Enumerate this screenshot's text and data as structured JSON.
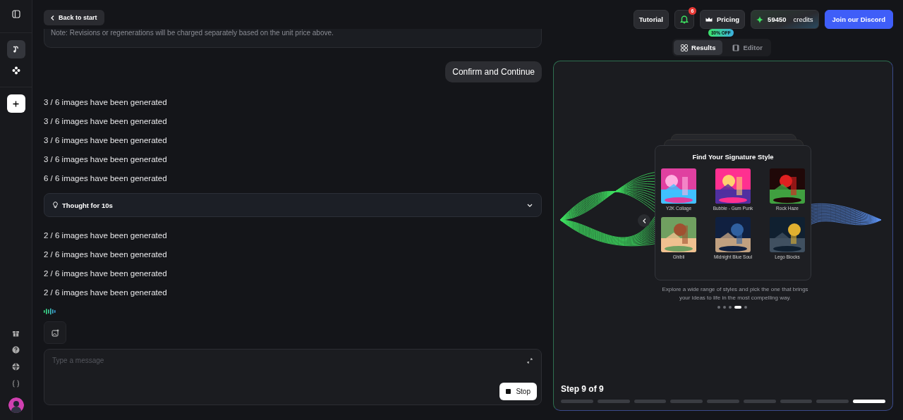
{
  "header": {
    "back": "Back to start",
    "tutorial": "Tutorial",
    "notifications": "6",
    "pricing": "Pricing",
    "discount": "30% OFF",
    "credits_value": "59450",
    "credits_label": "credits",
    "discord": "Join our Discord"
  },
  "view_tabs": [
    {
      "label": "Results",
      "selected": true
    },
    {
      "label": "Editor",
      "selected": false
    }
  ],
  "sidebar": {
    "items": [
      {
        "kind": "music",
        "selected": true
      },
      {
        "kind": "nodes",
        "selected": false
      }
    ]
  },
  "note": "Note: Revisions or regenerations will be charged separately based on the unit price above.",
  "user_message": "Confirm and Continue",
  "progress_messages_1": [
    "3 / 6 images have been generated",
    "3 / 6 images have been generated",
    "3 / 6 images have been generated",
    "3 / 6 images have been generated",
    "6 / 6 images have been generated"
  ],
  "thought": {
    "label": "Thought for 10s",
    "expanded": false
  },
  "progress_messages_2": [
    "2 / 6 images have been generated",
    "2 / 6 images have been generated",
    "2 / 6 images have been generated",
    "2 / 6 images have been generated"
  ],
  "composer": {
    "placeholder": "Type a message",
    "stop": "Stop"
  },
  "showcase": {
    "title": "Find Your Signature Style",
    "styles": [
      {
        "label": "Y2K Collage",
        "kind": "picture"
      },
      {
        "label": "Bubble - Gum Punk",
        "kind": "picture"
      },
      {
        "label": "Rock Haze",
        "kind": "picture"
      },
      {
        "label": "Ghibli",
        "kind": "picture"
      },
      {
        "label": "Midnight Blue Soul",
        "kind": "picture"
      },
      {
        "label": "Lego Blocks",
        "kind": "picture"
      }
    ],
    "description": "Explore a wide range of styles and pick the one that brings your ideas to life in the most compelling way.",
    "dots": [
      {
        "selected": false
      },
      {
        "selected": false
      },
      {
        "selected": false
      },
      {
        "selected": true
      },
      {
        "selected": false
      }
    ]
  },
  "step": {
    "label": "Step 9 of 9",
    "segments": [
      {
        "active": false
      },
      {
        "active": false
      },
      {
        "active": false
      },
      {
        "active": false
      },
      {
        "active": false
      },
      {
        "active": false
      },
      {
        "active": false
      },
      {
        "active": false
      },
      {
        "active": true
      }
    ]
  }
}
